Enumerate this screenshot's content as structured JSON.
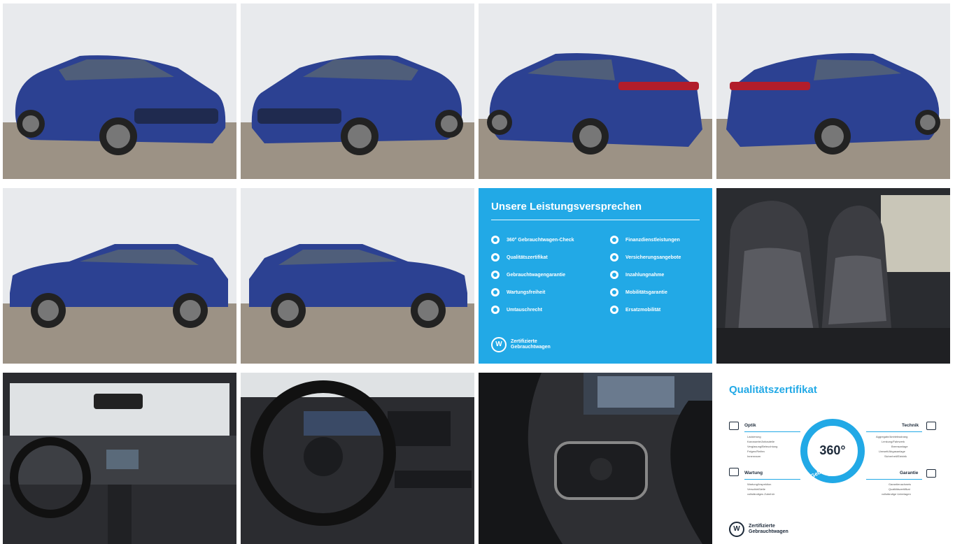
{
  "gallery": {
    "photos": [
      {
        "alt": "front-left-view"
      },
      {
        "alt": "front-right-view"
      },
      {
        "alt": "rear-left-view"
      },
      {
        "alt": "rear-right-view"
      },
      {
        "alt": "left-side-view"
      },
      {
        "alt": "right-side-view"
      },
      {
        "alt": "front-seats"
      },
      {
        "alt": "dashboard-wide"
      },
      {
        "alt": "cockpit-steering-wheel"
      },
      {
        "alt": "steering-wheel-controls"
      }
    ],
    "colors": {
      "car_blue": "#2b3f8f",
      "accent": "#22a9e6",
      "ground": "#9a8f82",
      "wall": "#e9ebee"
    }
  },
  "leistungen": {
    "title": "Unsere Leistungsversprechen",
    "left": [
      "360° Gebrauchtwagen-Check",
      "Qualitätszertifikat",
      "Gebrauchtwagengarantie",
      "Wartungsfreiheit",
      "Umtauschrecht"
    ],
    "right": [
      "Finanzdienstleistungen",
      "Versicherungsangebote",
      "Inzahlungnahme",
      "Mobilitätsgarantie",
      "Ersatzmobilität"
    ],
    "brand_line1": "Zertifizierte",
    "brand_line2": "Gebrauchtwagen"
  },
  "zertifikat": {
    "title": "Qualitätszertifikat",
    "center": "360°",
    "ring_label": "Gebrauchtwagen-Check",
    "optik": "Optik",
    "optik_items": [
      "Lackierung",
      "Karosserie/Anbauteile",
      "Verglasung/Beleuchtung",
      "Felgen/Reifen",
      "Innenraum"
    ],
    "technik": "Technik",
    "technik_items": [
      "Aggregate/Antriebsstrang",
      "Lenkung/Fahrwerk",
      "Bremsanlage",
      "Umwelt/Abgasanlage",
      "Sicherheit/Elektrik"
    ],
    "wartung": "Wartung",
    "wartung_items": [
      "Wartung/Inspektion",
      "Verschleißteile",
      "vollständiges Zubehör"
    ],
    "garantie": "Garantie",
    "garantie_items": [
      "Garantienachweis",
      "Qualitätszertifikat",
      "vollständige Unterlagen"
    ],
    "brand_line1": "Zertifizierte",
    "brand_line2": "Gebrauchtwagen"
  }
}
